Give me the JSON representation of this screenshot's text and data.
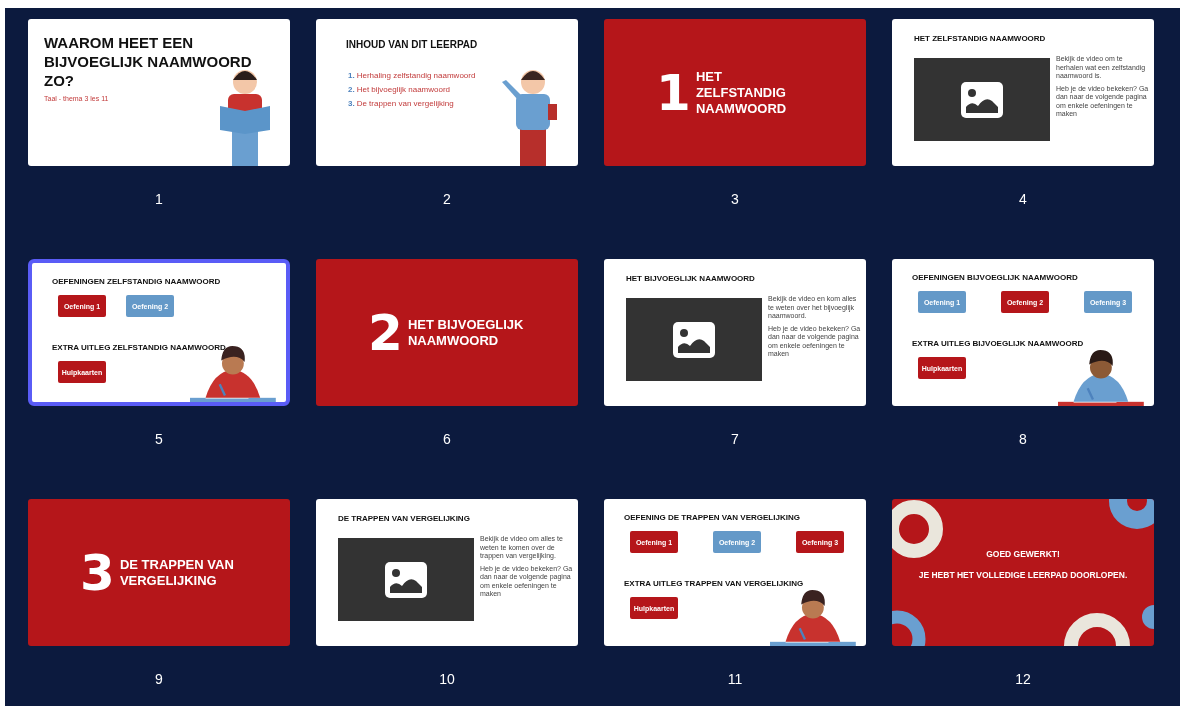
{
  "slides": [
    {
      "number": "1",
      "selected": false,
      "kind": "title",
      "title": "WAAROM HEET EEN BIJVOEGLIJK NAAMWOORD ZO?",
      "subtitle": "Taal - thema 3 les 11",
      "figure": {
        "kind": "reader"
      }
    },
    {
      "number": "2",
      "selected": false,
      "kind": "agenda",
      "title": "INHOUD VAN DIT LEERPAD",
      "items": [
        {
          "marker": "1.",
          "text": "Herhaling zelfstandig naamwoord"
        },
        {
          "marker": "2.",
          "text": "Het bijvoeglijk naamwoord"
        },
        {
          "marker": "3.",
          "text": "De trappen van vergelijking"
        }
      ],
      "figure": {
        "kind": "teacher"
      }
    },
    {
      "number": "3",
      "selected": false,
      "kind": "section",
      "digit": "1",
      "title": "HET ZELFSTANDIG NAAMWOORD"
    },
    {
      "number": "4",
      "selected": false,
      "kind": "video",
      "title": "HET ZELFSTANDIG NAAMWOORD",
      "paragraphs": [
        "Bekijk de video om te herhalen wat een zelfstandig naamwoord is.",
        "Heb je de video bekeken? Ga dan naar de volgende pagina om enkele oefeningen te maken"
      ]
    },
    {
      "number": "5",
      "selected": true,
      "kind": "exercises",
      "title": "OEFENINGEN ZELFSTANDIG NAAMWOORD",
      "buttons": [
        {
          "label": "Oefening 1",
          "color": "#b5161a"
        },
        {
          "label": "Oefening 2",
          "color": "#6499c8"
        }
      ],
      "extra_title": "EXTRA UITLEG ZELFSTANDIG NAAMWOORD",
      "extra_buttons": [
        {
          "label": "Hulpkaarten",
          "color": "#b5161a"
        }
      ],
      "figure": {
        "kind": "writer"
      }
    },
    {
      "number": "6",
      "selected": false,
      "kind": "section",
      "digit": "2",
      "title": "HET BIJVOEGLIJK NAAMWOORD"
    },
    {
      "number": "7",
      "selected": false,
      "kind": "video",
      "title": "HET BIJVOEGLIJK NAAMWOORD",
      "paragraphs": [
        "Bekijk de video en kom alles te weten over het bijvoeglijk naamwoord.",
        "Heb je de video bekeken? Ga dan naar de volgende pagina om enkele oefeningen te maken"
      ]
    },
    {
      "number": "8",
      "selected": false,
      "kind": "exercises",
      "title": "OEFENINGEN BIJVOEGLIJK NAAMWOORD",
      "buttons": [
        {
          "label": "Oefening 1",
          "color": "#6499c8"
        },
        {
          "label": "Oefening 2",
          "color": "#b5161a"
        },
        {
          "label": "Oefening 3",
          "color": "#6499c8"
        }
      ],
      "extra_title": "EXTRA UITLEG BIJVOEGLIJK NAAMWOORD",
      "extra_buttons": [
        {
          "label": "Hulpkaarten",
          "color": "#b5161a"
        }
      ],
      "figure": {
        "kind": "girl"
      }
    },
    {
      "number": "9",
      "selected": false,
      "kind": "section",
      "digit": "3",
      "title": "DE TRAPPEN VAN VERGELIJKING"
    },
    {
      "number": "10",
      "selected": false,
      "kind": "video",
      "title": "DE TRAPPEN VAN VERGELIJKING",
      "paragraphs": [
        "Bekijk de video om alles te weten te komen over de trappen van vergelijking.",
        "Heb je de video bekeken? Ga dan naar de volgende pagina om enkele oefeningen te maken"
      ]
    },
    {
      "number": "11",
      "selected": false,
      "kind": "exercises",
      "title": "OEFENING DE TRAPPEN VAN VERGELIJKING",
      "buttons": [
        {
          "label": "Oefening 1",
          "color": "#b5161a"
        },
        {
          "label": "Oefening 2",
          "color": "#6499c8"
        },
        {
          "label": "Oefening 3",
          "color": "#b5161a"
        }
      ],
      "extra_title": "EXTRA UITLEG TRAPPEN VAN VERGELIJKING",
      "extra_buttons": [
        {
          "label": "Hulpkaarten",
          "color": "#b5161a"
        }
      ],
      "figure": {
        "kind": "writer"
      }
    },
    {
      "number": "12",
      "selected": false,
      "kind": "end",
      "lines": [
        "GOED GEWERKT!",
        "JE HEBT HET VOLLEDIGE LEERPAD DOORLOPEN."
      ]
    }
  ]
}
